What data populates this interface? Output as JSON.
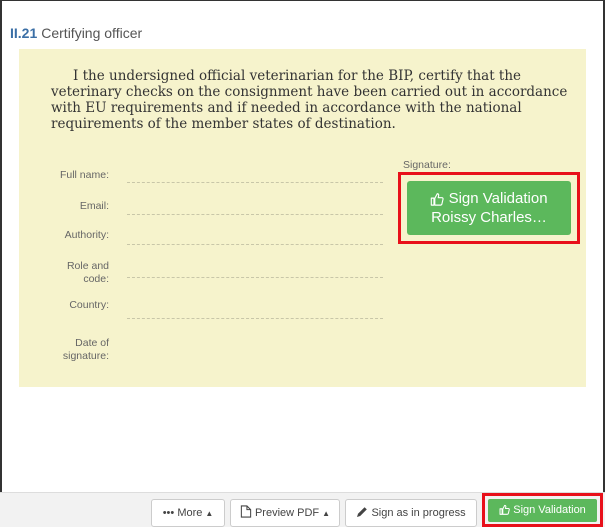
{
  "section": {
    "number": "II.21",
    "title": "Certifying officer"
  },
  "certificate": {
    "statement": "I the undersigned official veterinarian for the BIP, certify that the veterinary checks on the consignment have been carried out in accordance with EU requirements and if needed in accordance with the national requirements of the member states of destination."
  },
  "fields": {
    "full_name": "Full name:",
    "email": "Email:",
    "authority": "Authority:",
    "role_and_code": "Role and code:",
    "country": "Country:",
    "date_of_signature": "Date of signature:"
  },
  "signature": {
    "label": "Signature:",
    "button_line1": "Sign Validation",
    "button_line2": "Roissy Charles…"
  },
  "toolbar": {
    "more_label": "More",
    "preview_label": "Preview PDF",
    "sign_progress_label": "Sign as in progress",
    "sign_validation_label": "Sign Validation"
  },
  "colors": {
    "accent_green": "#5cb85c",
    "highlight_red": "#e8101a",
    "cert_background": "#f6f3cc",
    "section_number_blue": "#3b6fa6"
  }
}
